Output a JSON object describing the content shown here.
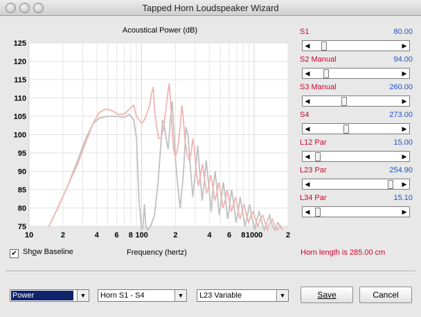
{
  "window": {
    "title": "Tapped Horn Loudspeaker Wizard"
  },
  "chart_data": {
    "type": "line",
    "title": "Acoustical Power (dB)",
    "xlabel": "Frequency (hertz)",
    "ylabel": "",
    "x_scale": "log",
    "xlim": [
      10,
      2000
    ],
    "ylim": [
      75,
      125
    ],
    "y_ticks": [
      "125",
      "120",
      "115",
      "110",
      "105",
      "100",
      "95",
      "90",
      "85",
      "80",
      "75"
    ],
    "x_tick_labels": [
      {
        "x": 10,
        "label": "10"
      },
      {
        "x": 20,
        "label": "2"
      },
      {
        "x": 40,
        "label": "4"
      },
      {
        "x": 60,
        "label": "6"
      },
      {
        "x": 80,
        "label": "8"
      },
      {
        "x": 100,
        "label": "100"
      },
      {
        "x": 200,
        "label": "2"
      },
      {
        "x": 400,
        "label": "4"
      },
      {
        "x": 600,
        "label": "6"
      },
      {
        "x": 800,
        "label": "8"
      },
      {
        "x": 1000,
        "label": "1000"
      },
      {
        "x": 2000,
        "label": "2"
      }
    ],
    "grid": true,
    "series": [
      {
        "color": "#c0c0c0",
        "points": [
          [
            15,
            75
          ],
          [
            18,
            80
          ],
          [
            22,
            86
          ],
          [
            27,
            93
          ],
          [
            32,
            99
          ],
          [
            37,
            103
          ],
          [
            42,
            104.5
          ],
          [
            50,
            105
          ],
          [
            60,
            105
          ],
          [
            70,
            104.7
          ],
          [
            78,
            105.5
          ],
          [
            85,
            104
          ],
          [
            90,
            99
          ],
          [
            95,
            82
          ],
          [
            100,
            74
          ],
          [
            103,
            75
          ],
          [
            106,
            81
          ],
          [
            109,
            75
          ],
          [
            113,
            74
          ],
          [
            120,
            75
          ],
          [
            130,
            78
          ],
          [
            140,
            87
          ],
          [
            148,
            97
          ],
          [
            153,
            104
          ],
          [
            158,
            103
          ],
          [
            165,
            99
          ],
          [
            172,
            96
          ],
          [
            180,
            104
          ],
          [
            187,
            109
          ],
          [
            192,
            103
          ],
          [
            200,
            93
          ],
          [
            210,
            86
          ],
          [
            220,
            80
          ],
          [
            235,
            89
          ],
          [
            248,
            102
          ],
          [
            258,
            100
          ],
          [
            270,
            92
          ],
          [
            285,
            83
          ],
          [
            300,
            90
          ],
          [
            315,
            97
          ],
          [
            328,
            90
          ],
          [
            345,
            82
          ],
          [
            360,
            87
          ],
          [
            375,
            93
          ],
          [
            395,
            86
          ],
          [
            415,
            79
          ],
          [
            430,
            85
          ],
          [
            450,
            90
          ],
          [
            470,
            84
          ],
          [
            490,
            78
          ],
          [
            510,
            82
          ],
          [
            530,
            87
          ],
          [
            555,
            83
          ],
          [
            580,
            77
          ],
          [
            600,
            80
          ],
          [
            630,
            85
          ],
          [
            660,
            81
          ],
          [
            690,
            76
          ],
          [
            720,
            79
          ],
          [
            750,
            83
          ],
          [
            790,
            79
          ],
          [
            830,
            75
          ],
          [
            870,
            78
          ],
          [
            910,
            81
          ],
          [
            960,
            77
          ],
          [
            1010,
            74
          ],
          [
            1060,
            77
          ],
          [
            1110,
            79
          ],
          [
            1170,
            76
          ],
          [
            1230,
            74
          ],
          [
            1300,
            76
          ],
          [
            1370,
            78
          ],
          [
            1450,
            75
          ],
          [
            1530,
            74
          ],
          [
            1620,
            76
          ],
          [
            1720,
            75
          ],
          [
            1800,
            74
          ]
        ]
      },
      {
        "color": "#f2b3b3",
        "points": [
          [
            15,
            75
          ],
          [
            18,
            80
          ],
          [
            22,
            86
          ],
          [
            27,
            92
          ],
          [
            32,
            98
          ],
          [
            37,
            103
          ],
          [
            42,
            106
          ],
          [
            48,
            107
          ],
          [
            55,
            106.5
          ],
          [
            62,
            105.5
          ],
          [
            70,
            105.5
          ],
          [
            78,
            107
          ],
          [
            85,
            108
          ],
          [
            90,
            105
          ],
          [
            95,
            104
          ],
          [
            100,
            103
          ],
          [
            106,
            104
          ],
          [
            112,
            106
          ],
          [
            118,
            108
          ],
          [
            122,
            111
          ],
          [
            127,
            113
          ],
          [
            130,
            107
          ],
          [
            136,
            102
          ],
          [
            142,
            99
          ],
          [
            148,
            99
          ],
          [
            155,
            101
          ],
          [
            160,
            104
          ],
          [
            166,
            108
          ],
          [
            172,
            112
          ],
          [
            176,
            114
          ],
          [
            180,
            110
          ],
          [
            186,
            102
          ],
          [
            192,
            96
          ],
          [
            200,
            94
          ],
          [
            208,
            96
          ],
          [
            215,
            99
          ],
          [
            222,
            104
          ],
          [
            228,
            108
          ],
          [
            234,
            105
          ],
          [
            242,
            99
          ],
          [
            252,
            95
          ],
          [
            265,
            93
          ],
          [
            275,
            95
          ],
          [
            285,
            99
          ],
          [
            296,
            95
          ],
          [
            308,
            89
          ],
          [
            320,
            86
          ],
          [
            334,
            89
          ],
          [
            348,
            92
          ],
          [
            362,
            88
          ],
          [
            378,
            84
          ],
          [
            395,
            86
          ],
          [
            410,
            89
          ],
          [
            428,
            86
          ],
          [
            446,
            82
          ],
          [
            465,
            84
          ],
          [
            485,
            87
          ],
          [
            505,
            84
          ],
          [
            528,
            80
          ],
          [
            552,
            82
          ],
          [
            575,
            85
          ],
          [
            600,
            82
          ],
          [
            628,
            79
          ],
          [
            655,
            81
          ],
          [
            685,
            83
          ],
          [
            715,
            80
          ],
          [
            748,
            77
          ],
          [
            782,
            79
          ],
          [
            815,
            81
          ],
          [
            855,
            78
          ],
          [
            895,
            76
          ],
          [
            935,
            78
          ],
          [
            980,
            79
          ],
          [
            1025,
            77
          ],
          [
            1080,
            75
          ],
          [
            1130,
            77
          ],
          [
            1190,
            78
          ],
          [
            1250,
            76
          ],
          [
            1310,
            74
          ],
          [
            1380,
            76
          ],
          [
            1450,
            77
          ],
          [
            1520,
            75
          ],
          [
            1600,
            74
          ],
          [
            1680,
            75
          ],
          [
            1800,
            74
          ]
        ]
      }
    ]
  },
  "parameters": [
    {
      "label": "S1",
      "value": "80.00",
      "fraction": 0.12
    },
    {
      "label": "S2  Manual",
      "value": "94.00",
      "fraction": 0.14
    },
    {
      "label": "S3  Manual",
      "value": "260.00",
      "fraction": 0.36
    },
    {
      "label": "S4",
      "value": "273.00",
      "fraction": 0.38
    },
    {
      "label": "L12  Par",
      "value": "15.00",
      "fraction": 0.04
    },
    {
      "label": "L23  Par",
      "value": "254.90",
      "fraction": 0.92
    },
    {
      "label": "L34  Par",
      "value": "15.10",
      "fraction": 0.04
    }
  ],
  "horn_length": "Horn length is 285.00 cm",
  "show_baseline": {
    "label": "Show Baseline",
    "checked": true,
    "check_glyph": "✔"
  },
  "controls": {
    "plot_select": "Power",
    "horn_select": "Horn S1 - S4",
    "variable_select": "L23 Variable",
    "save_label": "Save",
    "cancel_label": "Cancel"
  },
  "colors": {
    "label_red": "#d0002a",
    "value_blue": "#1e50c8",
    "baseline_gray": "#c0c0c0",
    "current_pink": "#f2b3b3"
  }
}
